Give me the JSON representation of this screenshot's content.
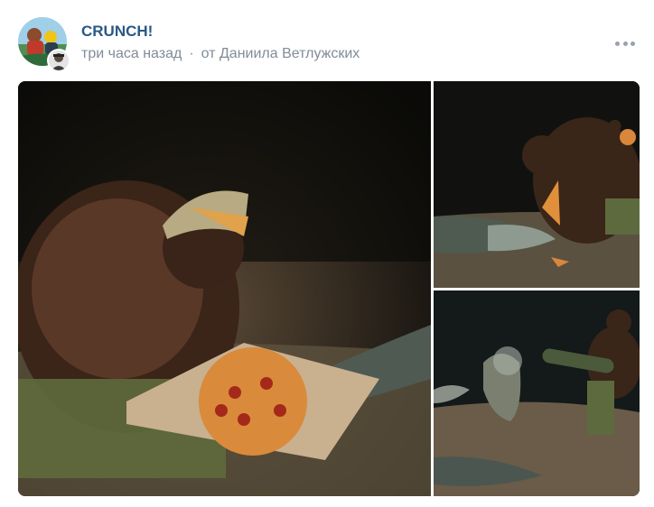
{
  "post": {
    "author": "CRUNCH!",
    "time": "три часа назад",
    "separator": "·",
    "by_label": "от Даниила Ветлужских",
    "more_icon": "more-horizontal-icon"
  },
  "photos": [
    {
      "alt": "photo-1"
    },
    {
      "alt": "photo-2"
    },
    {
      "alt": "photo-3"
    }
  ],
  "colors": {
    "link": "#2a5885",
    "meta": "#818c99",
    "dots": "#99a2ad"
  }
}
